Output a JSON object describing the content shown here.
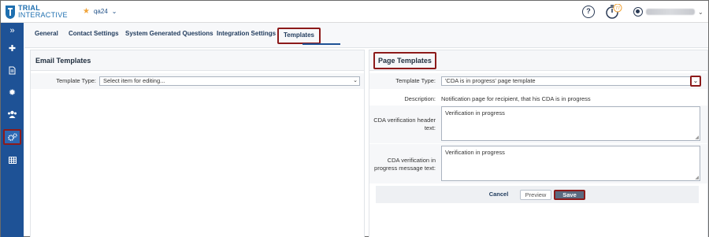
{
  "brand": {
    "line1": "TRIAL",
    "line2": "INTERACTIVE"
  },
  "study": {
    "name": "qa24"
  },
  "header": {
    "help_icon": "?",
    "timer_badge": "77"
  },
  "nav_icons": [
    "expand-icon",
    "plus-icon",
    "document-icon",
    "gear-badge-icon",
    "users-icon",
    "admin-cogs-icon",
    "grid-icon"
  ],
  "tabs": [
    {
      "label": "General"
    },
    {
      "label": "Contact Settings"
    },
    {
      "label": "System Generated Questions"
    },
    {
      "label": "Integration Settings"
    },
    {
      "label": "Templates"
    }
  ],
  "email": {
    "title": "Email Templates",
    "type_label": "Template Type:",
    "type_value": "Select item for editing..."
  },
  "page": {
    "title": "Page Templates",
    "type_label": "Template Type:",
    "type_value": "'CDA is in progress' page template",
    "desc_label": "Description:",
    "desc_value": "Notification page for recipient, that his CDA is in progress",
    "header_label": "CDA verification header text:",
    "header_value": "Verification in progress",
    "message_label": "CDA verification in progress message text:",
    "message_value": "Verification in progress"
  },
  "buttons": {
    "cancel": "Cancel",
    "preview": "Preview",
    "save": "Save"
  },
  "colors": {
    "nav": "#1e5296",
    "highlight": "#8c1a1a",
    "accent": "#f0a43a"
  }
}
